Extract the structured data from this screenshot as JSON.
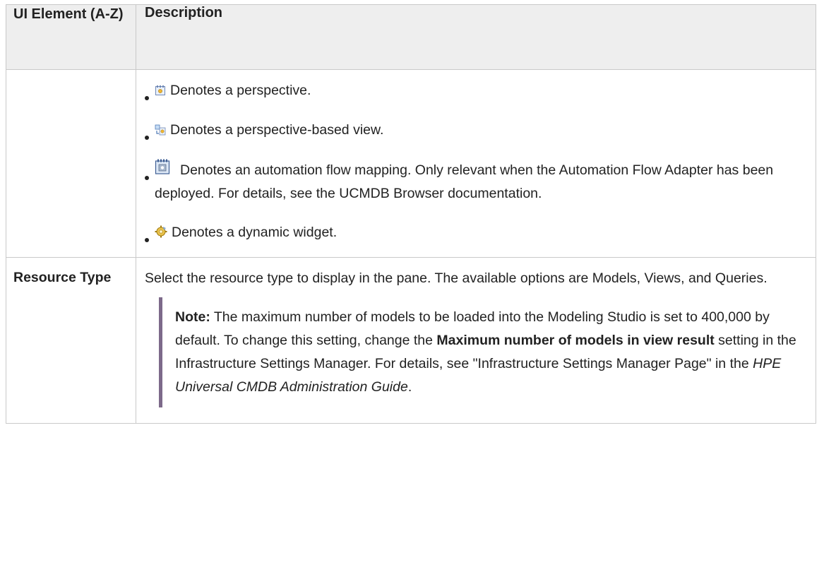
{
  "table": {
    "headers": {
      "element": "UI Element (A-Z)",
      "description": "Description"
    },
    "icon_rows": {
      "items": [
        {
          "icon": "perspective-icon",
          "text": "Denotes a perspective."
        },
        {
          "icon": "perspective-based-view-icon",
          "text": "Denotes a perspective-based view."
        },
        {
          "icon": "automation-flow-mapping-icon",
          "text": "Denotes an automation flow mapping. Only relevant when the Automation Flow Adapter has been deployed. For details, see the UCMDB Browser documentation."
        },
        {
          "icon": "dynamic-widget-icon",
          "text": "Denotes a dynamic widget."
        }
      ]
    },
    "resource_type": {
      "element": "Resource Type",
      "description": "Select the resource type to display in the pane. The available options are Models, Views, and Queries.",
      "note": {
        "label": "Note:",
        "text1": " The maximum number of models to be loaded into the Modeling Studio is set to 400,000 by default. To change this setting, change the ",
        "bold_setting": "Maximum number of models in view result",
        "text2": " setting in the Infrastructure Settings Manager. For details, see \"Infrastructure Settings Manager Page\" in the ",
        "guide": "HPE Universal CMDB Administration Guide",
        "end": "."
      }
    }
  },
  "colors": {
    "header_bg": "#eeeeee",
    "border": "#c9c9c9",
    "note_bar": "#7d6a8a"
  }
}
